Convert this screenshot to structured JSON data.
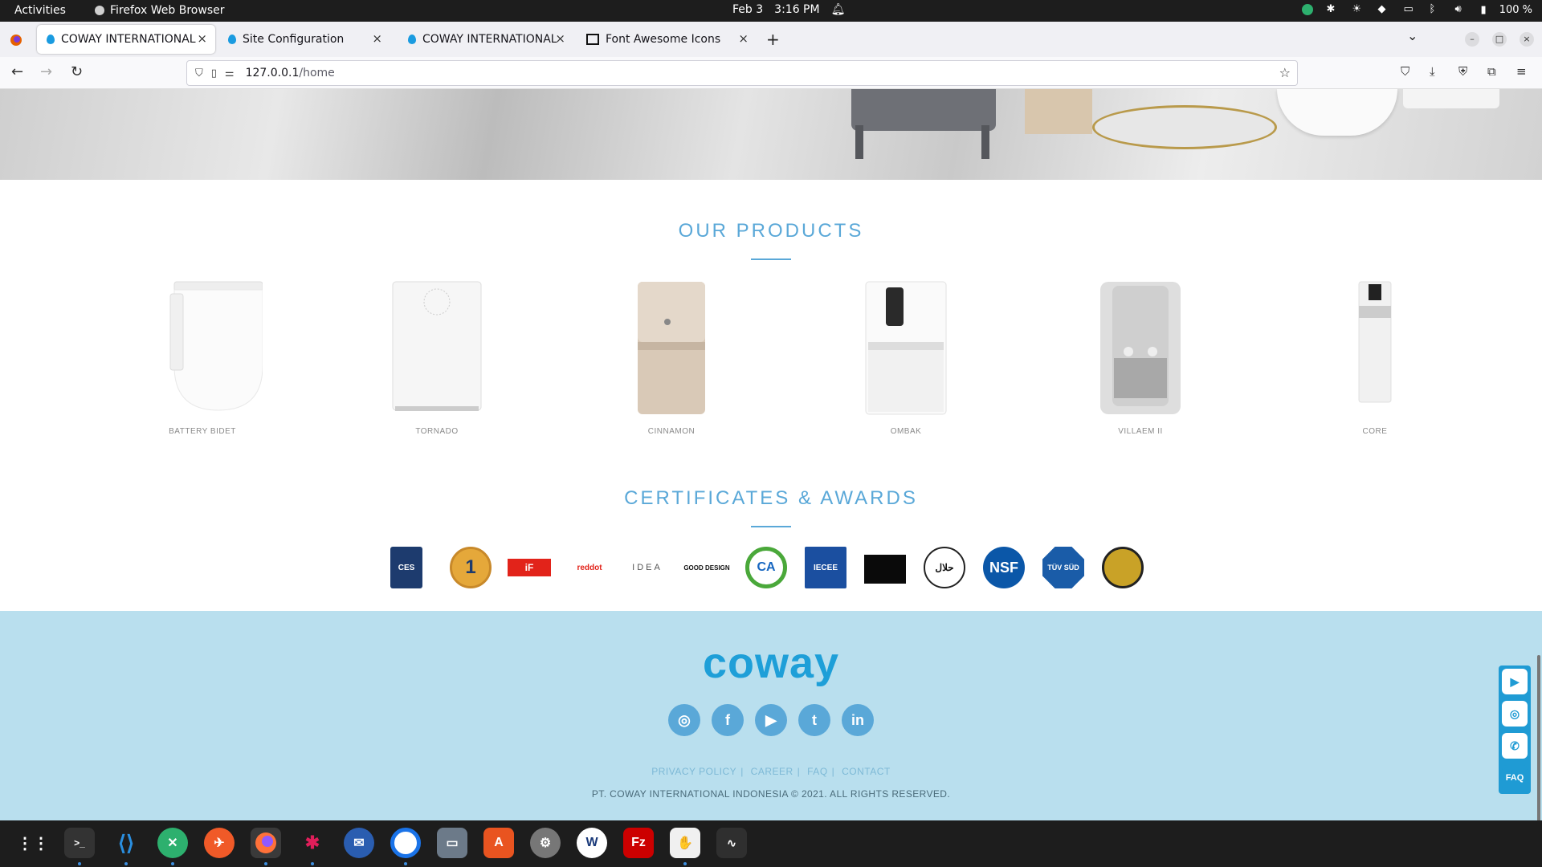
{
  "topbar": {
    "activities": "Activities",
    "app_name": "Firefox Web Browser",
    "date": "Feb 3",
    "time": "3:16 PM",
    "battery": "100 %"
  },
  "tabs": [
    {
      "title": "COWAY INTERNATIONAL",
      "active": true
    },
    {
      "title": "Site Configuration",
      "active": false
    },
    {
      "title": "COWAY INTERNATIONAL",
      "active": false
    },
    {
      "title": "Font Awesome Icons",
      "active": false
    }
  ],
  "url": {
    "host": "127.0.0.1",
    "path": "/home"
  },
  "products": {
    "title": "OUR PRODUCTS",
    "items": [
      {
        "name": "BATTERY BIDET"
      },
      {
        "name": "TORNADO"
      },
      {
        "name": "CINNAMON"
      },
      {
        "name": "OMBAK"
      },
      {
        "name": "VILLAEM II"
      },
      {
        "name": "CORE"
      }
    ]
  },
  "certificates": {
    "title": "CERTIFICATES & AWARDS",
    "badges": [
      {
        "text": "CES"
      },
      {
        "text": "1"
      },
      {
        "text": "iF"
      },
      {
        "text": "reddot"
      },
      {
        "text": "IDEA"
      },
      {
        "text": "GOOD DESIGN"
      },
      {
        "text": "CA"
      },
      {
        "text": "IECEE"
      },
      {
        "text": ""
      },
      {
        "text": "حلال"
      },
      {
        "text": "NSF"
      },
      {
        "text": "TÜV SÜD"
      },
      {
        "text": ""
      }
    ]
  },
  "footer": {
    "logo": "coway",
    "links": [
      "PRIVACY POLICY",
      "CAREER",
      "FAQ",
      "CONTACT"
    ],
    "copyright": "PT. COWAY INTERNATIONAL INDONESIA © 2021. ALL RIGHTS RESERVED."
  },
  "social_icons": [
    "instagram-icon",
    "facebook-icon",
    "youtube-icon",
    "twitter-icon",
    "linkedin-icon"
  ],
  "floating": {
    "faq": "FAQ"
  },
  "colors": {
    "accent": "#5aa8d8",
    "footer_bg": "#b9dfee",
    "logo": "#1e9fd8"
  }
}
